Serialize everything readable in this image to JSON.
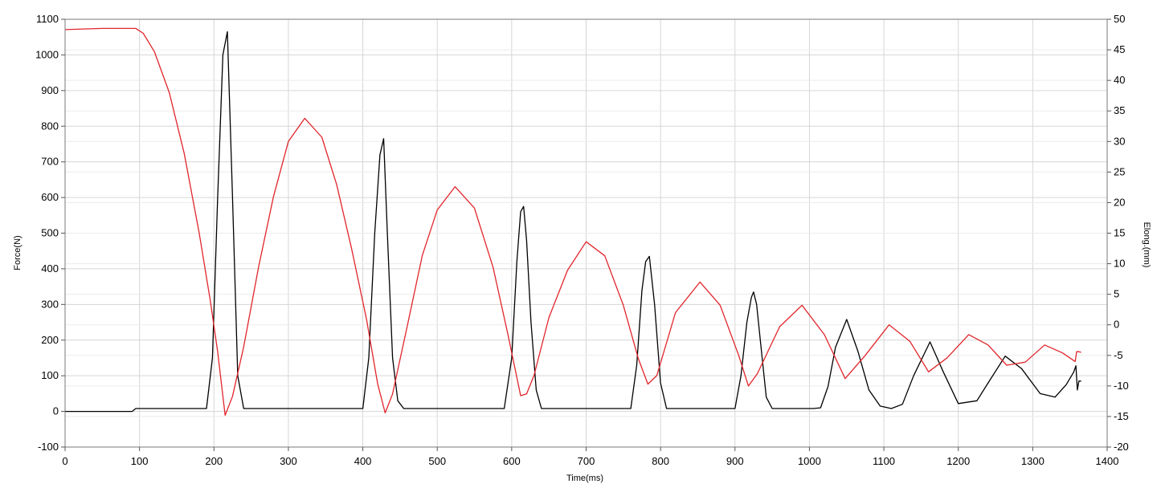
{
  "chart_data": {
    "type": "line",
    "title": "",
    "xlabel": "Time(ms)",
    "ylabel": "Force(N)",
    "y2label": "Elong.(mm)",
    "xlim": [
      0,
      1400
    ],
    "ylim": [
      -100,
      1100
    ],
    "y2lim": [
      -20,
      50
    ],
    "grid": true,
    "x_ticks": [
      0,
      100,
      200,
      300,
      400,
      500,
      600,
      700,
      800,
      900,
      1000,
      1100,
      1200,
      1300,
      1400
    ],
    "y_ticks": [
      -100,
      0,
      100,
      200,
      300,
      400,
      500,
      600,
      700,
      800,
      900,
      1000,
      1100
    ],
    "y2_ticks": [
      -20,
      -15,
      -10,
      -5,
      0,
      5,
      10,
      15,
      20,
      25,
      30,
      35,
      40,
      45,
      50
    ],
    "series": [
      {
        "axis": "left",
        "color": "#000000",
        "x": [
          0,
          90,
          95,
          100,
          190,
          198,
          205,
          212,
          218,
          225,
          232,
          240,
          400,
          408,
          416,
          423,
          428,
          433,
          440,
          447,
          455,
          590,
          600,
          607,
          612,
          616,
          620,
          626,
          633,
          640,
          760,
          768,
          775,
          780,
          785,
          792,
          800,
          808,
          900,
          908,
          916,
          922,
          925,
          929,
          935,
          942,
          950,
          1005,
          1015,
          1025,
          1035,
          1050,
          1065,
          1080,
          1095,
          1110,
          1125,
          1140,
          1162,
          1180,
          1200,
          1225,
          1240,
          1263,
          1285,
          1310,
          1330,
          1345,
          1355,
          1358,
          1360,
          1362,
          1365
        ],
        "values": [
          0,
          0,
          8,
          8,
          8,
          150,
          600,
          1000,
          1065,
          600,
          100,
          8,
          8,
          150,
          500,
          720,
          765,
          500,
          150,
          30,
          8,
          8,
          150,
          420,
          560,
          575,
          480,
          250,
          60,
          8,
          8,
          130,
          340,
          420,
          435,
          300,
          80,
          8,
          8,
          100,
          250,
          320,
          335,
          300,
          180,
          40,
          8,
          8,
          10,
          70,
          180,
          258,
          170,
          60,
          15,
          8,
          20,
          100,
          195,
          110,
          22,
          30,
          80,
          155,
          120,
          50,
          40,
          75,
          110,
          128,
          60,
          85,
          85
        ]
      },
      {
        "axis": "right",
        "color": "#e0252b",
        "x": [
          0,
          50,
          90,
          95,
          105,
          120,
          140,
          160,
          180,
          195,
          205,
          215,
          225,
          240,
          260,
          280,
          300,
          322,
          345,
          365,
          385,
          405,
          420,
          430,
          440,
          460,
          480,
          500,
          524,
          550,
          575,
          595,
          612,
          620,
          630,
          650,
          675,
          700,
          725,
          750,
          770,
          783,
          795,
          820,
          853,
          880,
          905,
          918,
          930,
          960,
          990,
          1020,
          1048,
          1075,
          1107,
          1135,
          1160,
          1185,
          1214,
          1240,
          1265,
          1290,
          1316,
          1340,
          1357,
          1359,
          1362,
          1365
        ],
        "values": [
          48.3,
          48.5,
          48.5,
          48.5,
          47.7,
          44.7,
          38.0,
          28.1,
          15.1,
          4.0,
          -4.4,
          -14.8,
          -11.7,
          -3.6,
          9.5,
          21.0,
          30.0,
          33.8,
          30.7,
          22.9,
          12.4,
          0.9,
          -9.7,
          -14.4,
          -11.3,
          0.0,
          11.4,
          18.8,
          22.6,
          19.1,
          9.4,
          -1.6,
          -11.6,
          -11.3,
          -8.3,
          1.2,
          8.9,
          13.6,
          11.3,
          3.2,
          -5.5,
          -9.7,
          -8.3,
          2.0,
          7.0,
          3.2,
          -5.0,
          -10.0,
          -8.0,
          -0.3,
          3.2,
          -1.6,
          -8.8,
          -5.0,
          0.0,
          -2.7,
          -7.7,
          -5.4,
          -1.6,
          -3.3,
          -6.6,
          -6.1,
          -3.3,
          -4.6,
          -6.0,
          -4.4,
          -4.4,
          -4.5
        ]
      }
    ]
  }
}
